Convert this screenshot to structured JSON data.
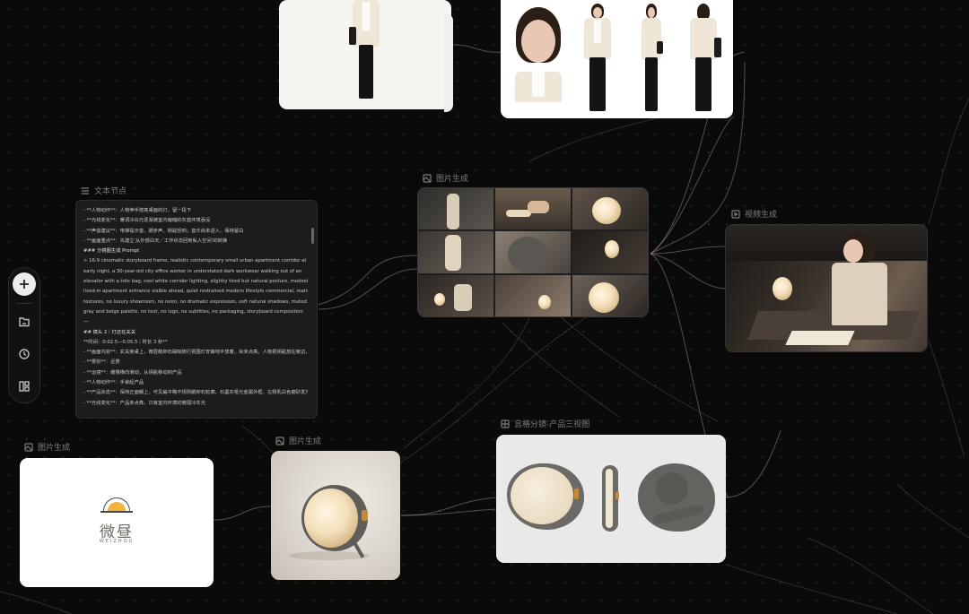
{
  "nodes": {
    "text_node": {
      "title": "文本节点",
      "lines": [
        "- **人物动作**：人物伸手按亮桌面的灯，留一段下",
        "- **光线变化**：暖调冷白光逐渐被室内偏暗的灰蓝环境吞没",
        "- **声音建议**：电梯提示音、脚步声、钥匙轻响；音乐尚未进入，保持留白",
        "- **画面重点**：先建立'从外部白天／工作状态回到私人空间'的转换",
        "### 分镜图生成 Prompt",
        "> 16:9 cinematic storyboard frame, realistic contemporary small urban apartment corridor at",
        "early night, a 30-year-old city office worker in understated dark workwear walking out of an",
        "elevator with a tote bag, cool white corridor lighting, slightly tired but natural posture, modest",
        "lived-in apartment entrance visible ahead, quiet restrained modern lifestyle commercial, realistic",
        "textures, no luxury showroom, no neon, no dramatic expression, soft natural shadows, muted",
        "gray and beige palette, no text, no logo, no subtitles, no packaging, storyboard composition",
        "---",
        "## 镜头 2｜灯还在关关",
        "**时间：0:02.5—0:05.5｜时长 3 秒**",
        "- **画面内容**：玄关旁桌上，微昼鹅卵石磁吸随行氛围灯安静地平放着，尚未点亮。人物把钥匙放在旁边，手从画面上方伸入。",
        "- **景别**：近景",
        "- **运镜**：缓慢横向滑动，从钥匙移动到产品",
        "- **人物动作**：手拿起产品",
        "- **产品状态**：保持正面朝上，可见扁平略不规则鹅卵石轮廓、石墨灰哑光金属外框、左侧乳白色磨砂发光面、右侧石墨灰控制区和蜂蜜琥珀色旋杆",
        "- **光线变化**：产品未点亮，只有室内环境的微弱冷灰光"
      ]
    },
    "grid_node": {
      "title": "图片生成"
    },
    "video_node": {
      "title": "视频生成"
    },
    "logo_node": {
      "title": "图片生成",
      "logo_cn": "微昼",
      "logo_en": "WEIZHOU"
    },
    "lamp_node": {
      "title": "图片生成"
    },
    "threeview_node": {
      "title": "宫格分镜-产品三视图"
    }
  },
  "toolbar": {
    "items": [
      "add-icon",
      "folder-icon",
      "history-icon",
      "layout-icon"
    ]
  },
  "colors": {
    "canvas": "#0a0a0a",
    "node_bg": "#1c1c1c",
    "label": "#7d7d7d",
    "wire": "#8a8a8a",
    "logo_sun": "#f3b23c"
  }
}
